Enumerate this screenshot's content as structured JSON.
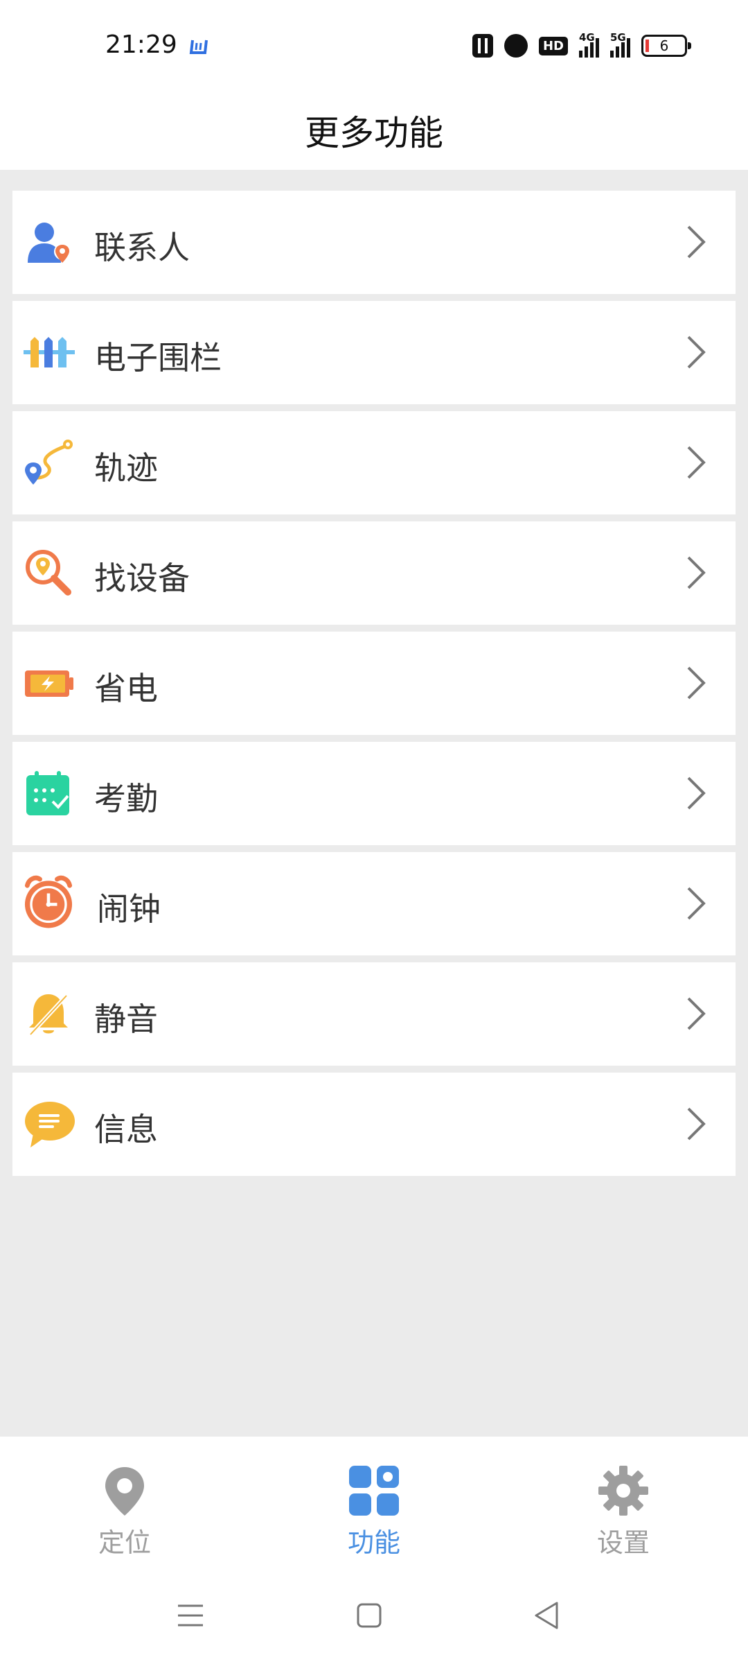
{
  "status_bar": {
    "time": "21:29",
    "network_4g": "4G",
    "network_5g": "5G",
    "hd": "HD",
    "battery": "6"
  },
  "header": {
    "title": "更多功能"
  },
  "menu": {
    "items": [
      {
        "label": "联系人",
        "icon": "contact-icon"
      },
      {
        "label": "电子围栏",
        "icon": "fence-icon"
      },
      {
        "label": "轨迹",
        "icon": "route-icon"
      },
      {
        "label": "找设备",
        "icon": "find-device-icon"
      },
      {
        "label": "省电",
        "icon": "battery-saver-icon"
      },
      {
        "label": "考勤",
        "icon": "attendance-icon"
      },
      {
        "label": "闹钟",
        "icon": "alarm-clock-icon"
      },
      {
        "label": "静音",
        "icon": "mute-bell-icon"
      },
      {
        "label": "信息",
        "icon": "message-icon"
      }
    ]
  },
  "tabs": [
    {
      "label": "定位",
      "icon": "location-pin-icon",
      "active": false
    },
    {
      "label": "功能",
      "icon": "grid-icon",
      "active": true
    },
    {
      "label": "设置",
      "icon": "gear-icon",
      "active": false
    }
  ],
  "colors": {
    "accent": "#4a90e2",
    "inactive": "#9e9e9e",
    "background": "#ebebeb"
  }
}
